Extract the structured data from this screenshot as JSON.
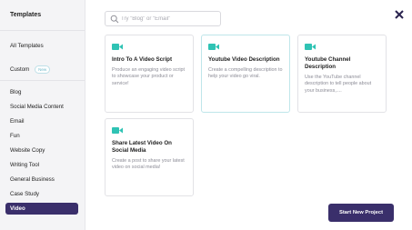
{
  "sidebar": {
    "title": "Templates",
    "all_templates": "All Templates",
    "custom": {
      "label": "Custom",
      "badge": "New"
    },
    "categories": [
      "Blog",
      "Social Media Content",
      "Email",
      "Fun",
      "Website Copy",
      "Writing Tool",
      "General Business",
      "Case Study",
      "Video"
    ],
    "active_category": "Video"
  },
  "search": {
    "placeholder": "Try \"Blog\" or \"Email\"",
    "value": ""
  },
  "cards": [
    {
      "title": "Intro To A Video Script",
      "description": "Produce an engaging video script to showcase your product or service!",
      "icon": "video-camera-icon"
    },
    {
      "title": "Youtube Video Description",
      "description": "Create a compelling description to help your video go viral.",
      "icon": "video-camera-icon"
    },
    {
      "title": "Youtube Channel Description",
      "description": "Use the YouTube channel description to tell people about your business,....",
      "icon": "video-camera-icon"
    },
    {
      "title": "Share Latest Video On Social Media",
      "description": "Create a post to share your latest video on social media!",
      "icon": "video-camera-icon"
    }
  ],
  "actions": {
    "start_new_project": "Start New Project"
  },
  "colors": {
    "accent": "#3a2f6b",
    "icon_teal": "#2fc3b4",
    "card_highlight_border": "#bfe6ea"
  }
}
